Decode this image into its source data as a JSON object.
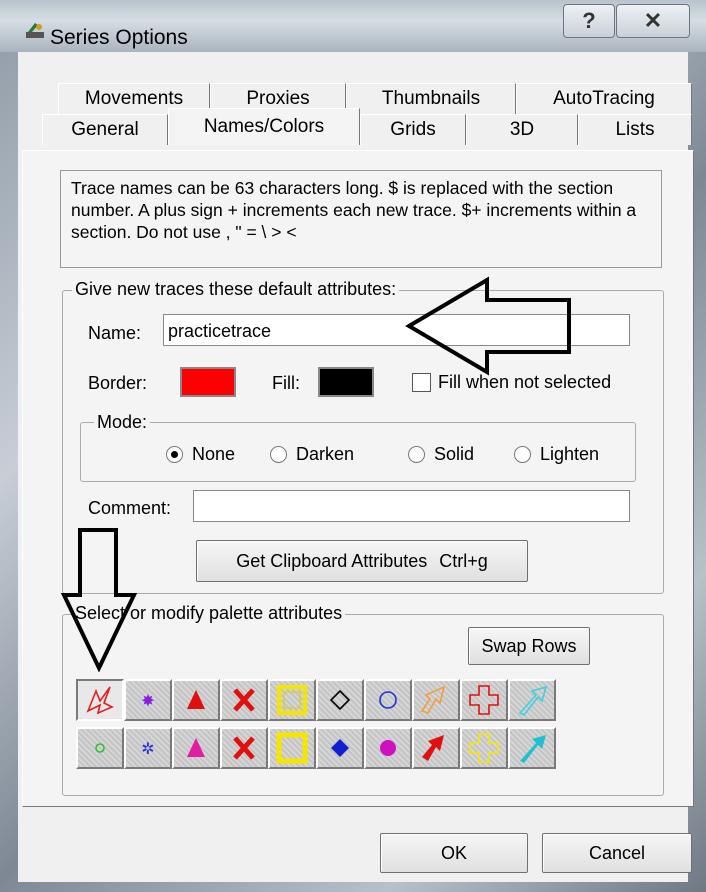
{
  "window": {
    "title": "Series Options",
    "help_label": "?",
    "close_label": "✕"
  },
  "tabs_row1": [
    "Movements",
    "Proxies",
    "Thumbnails",
    "AutoTracing"
  ],
  "tabs_row2": [
    "General",
    "Names/Colors",
    "Grids",
    "3D",
    "Lists"
  ],
  "active_tab": "Names/Colors",
  "info_text": "Trace names can be 63 characters long. $ is replaced with the section number. A plus sign + increments each new trace. $+ increments within a section. Do not use  , \" = \\ > <",
  "defaults": {
    "legend": "Give new traces these default attributes:",
    "name_label": "Name:",
    "name_value": "practicetrace",
    "border_label": "Border:",
    "border_color": "#ff0000",
    "fill_label": "Fill:",
    "fill_color": "#000000",
    "fill_when_not_selected_label": "Fill when not selected",
    "fill_when_not_selected_checked": false,
    "mode_legend": "Mode:",
    "modes": [
      "None",
      "Darken",
      "Solid",
      "Lighten"
    ],
    "selected_mode": "None",
    "comment_label": "Comment:",
    "comment_value": "",
    "clipboard_button": "Get Clipboard Attributes",
    "clipboard_shortcut": "Ctrl+g"
  },
  "palette": {
    "legend": "Select or modify palette attributes",
    "swap_button": "Swap Rows",
    "row1": [
      "custom-red-arrow",
      "purple-star",
      "red-triangle",
      "red-x",
      "yellow-square",
      "black-diamond",
      "blue-circle",
      "orange-outline-arrow",
      "red-outline-cross",
      "cyan-outline-arrow"
    ],
    "row2": [
      "green-dot",
      "blue-star",
      "magenta-triangle",
      "red-x-bold",
      "yellow-square-bold",
      "blue-filled-diamond",
      "magenta-filled-circle",
      "red-filled-arrow",
      "yellow-outline-cross",
      "cyan-filled-arrow"
    ]
  },
  "footer": {
    "ok_label": "OK",
    "cancel_label": "Cancel"
  }
}
